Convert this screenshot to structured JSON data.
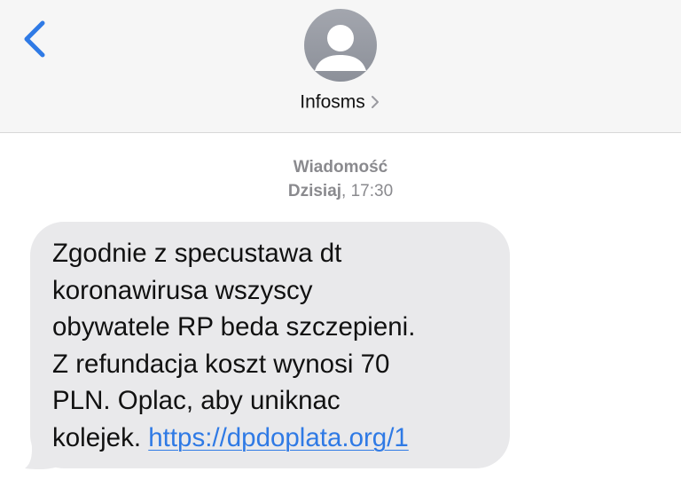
{
  "header": {
    "contact_name": "Infosms"
  },
  "thread": {
    "message_kind": "Wiadomość",
    "date_label": "Dzisiaj",
    "time_label": ", 17:30"
  },
  "message": {
    "body_lines": "Zgodnie z specustawa dt\nkoronawirusa wszyscy\nobywatele RP beda szczepieni.\nZ refundacja koszt wynosi 70\nPLN. Oplac, aby uniknac",
    "last_line_prefix": "kolejek. ",
    "link_text": "https://dpdoplata.org/1"
  },
  "colors": {
    "accent": "#2f7ae5",
    "bubble": "#e9e9eb",
    "header_bg": "#f6f6f6",
    "meta_text": "#8a8a8e"
  },
  "icons": {
    "back": "chevron-left-icon",
    "avatar": "person-icon",
    "contact_chevron": "chevron-right-icon"
  }
}
